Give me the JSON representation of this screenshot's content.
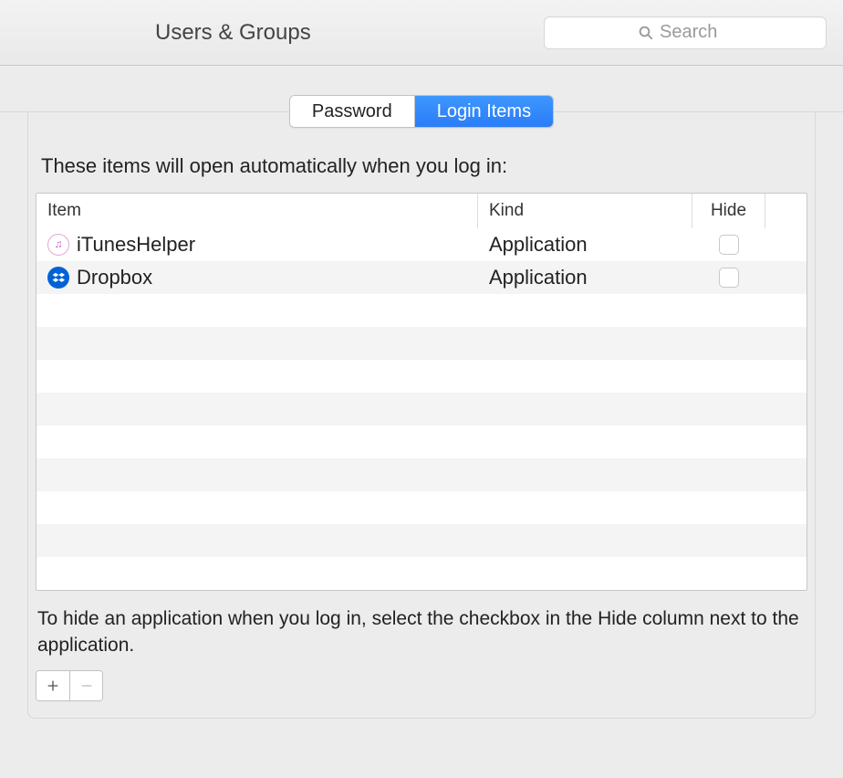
{
  "header": {
    "title": "Users & Groups",
    "search_placeholder": "Search"
  },
  "tabs": {
    "password": "Password",
    "login_items": "Login Items"
  },
  "panel": {
    "heading": "These items will open automatically when you log in:"
  },
  "table": {
    "columns": {
      "item": "Item",
      "kind": "Kind",
      "hide": "Hide"
    },
    "rows": [
      {
        "icon": "itunes",
        "name": "iTunesHelper",
        "kind": "Application",
        "hide": false
      },
      {
        "icon": "dropbox",
        "name": "Dropbox",
        "kind": "Application",
        "hide": false
      }
    ],
    "empty_row_count": 9
  },
  "help": "To hide an application when you log in, select the checkbox in the Hide column next to the application."
}
